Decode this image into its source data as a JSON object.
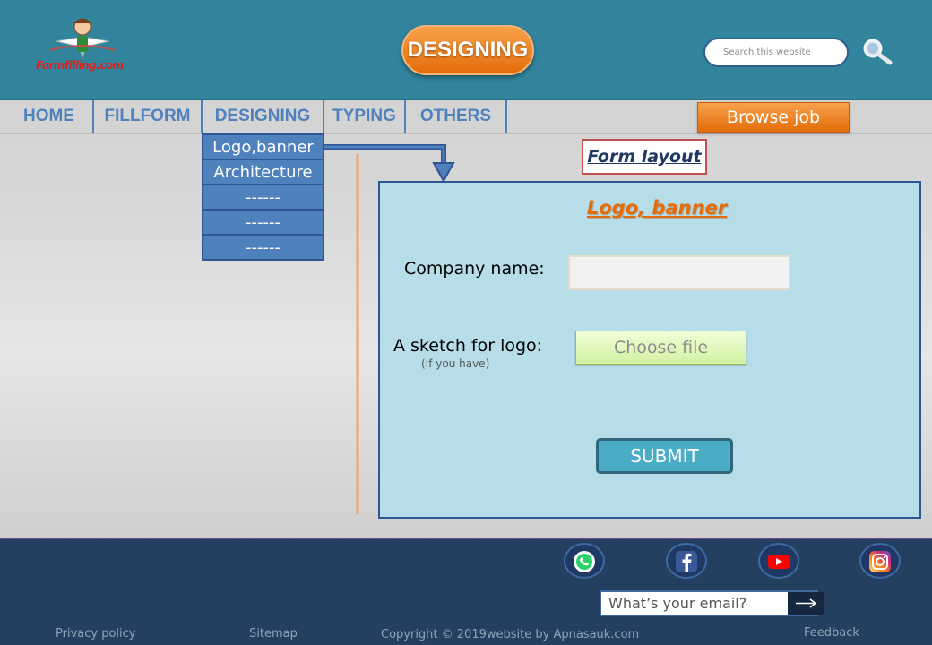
{
  "header": {
    "logo_text": "Formfilling.com",
    "page_badge": "DESIGNING",
    "search_placeholder": "Search this website",
    "search_icon": "magnifier-icon"
  },
  "nav": {
    "items": [
      {
        "label": "HOME"
      },
      {
        "label": "FILLFORM"
      },
      {
        "label": "DESIGNING"
      },
      {
        "label": "TYPING"
      },
      {
        "label": "OTHERS"
      }
    ],
    "browse_job": "Browse job"
  },
  "dropdown": {
    "items": [
      {
        "label": "Logo,banner"
      },
      {
        "label": "Architecture"
      },
      {
        "label": "------"
      },
      {
        "label": "------"
      },
      {
        "label": "------"
      }
    ]
  },
  "form_layout_label": "Form layout",
  "form": {
    "title": "Logo, banner",
    "company_label": "Company name:",
    "company_value": "",
    "sketch_label": "A sketch for logo:",
    "sketch_hint": "(If you have)",
    "choose_file": "Choose file",
    "submit": "SUBMIT"
  },
  "footer": {
    "social": [
      {
        "name": "whatsapp-icon"
      },
      {
        "name": "facebook-icon"
      },
      {
        "name": "youtube-icon"
      },
      {
        "name": "instagram-icon"
      }
    ],
    "email_placeholder": "What’s your email?",
    "links": {
      "privacy": "Privacy policy",
      "sitemap": "Sitemap",
      "feedback": "Feedback"
    },
    "copyright": "Copyright © 2019website by Apnasauk.com"
  },
  "colors": {
    "header_bg": "#31849b",
    "nav_text": "#4f81bd",
    "accent_orange": "#e46c0a",
    "form_bg": "#b7dde8",
    "footer_bg": "#243f60"
  }
}
